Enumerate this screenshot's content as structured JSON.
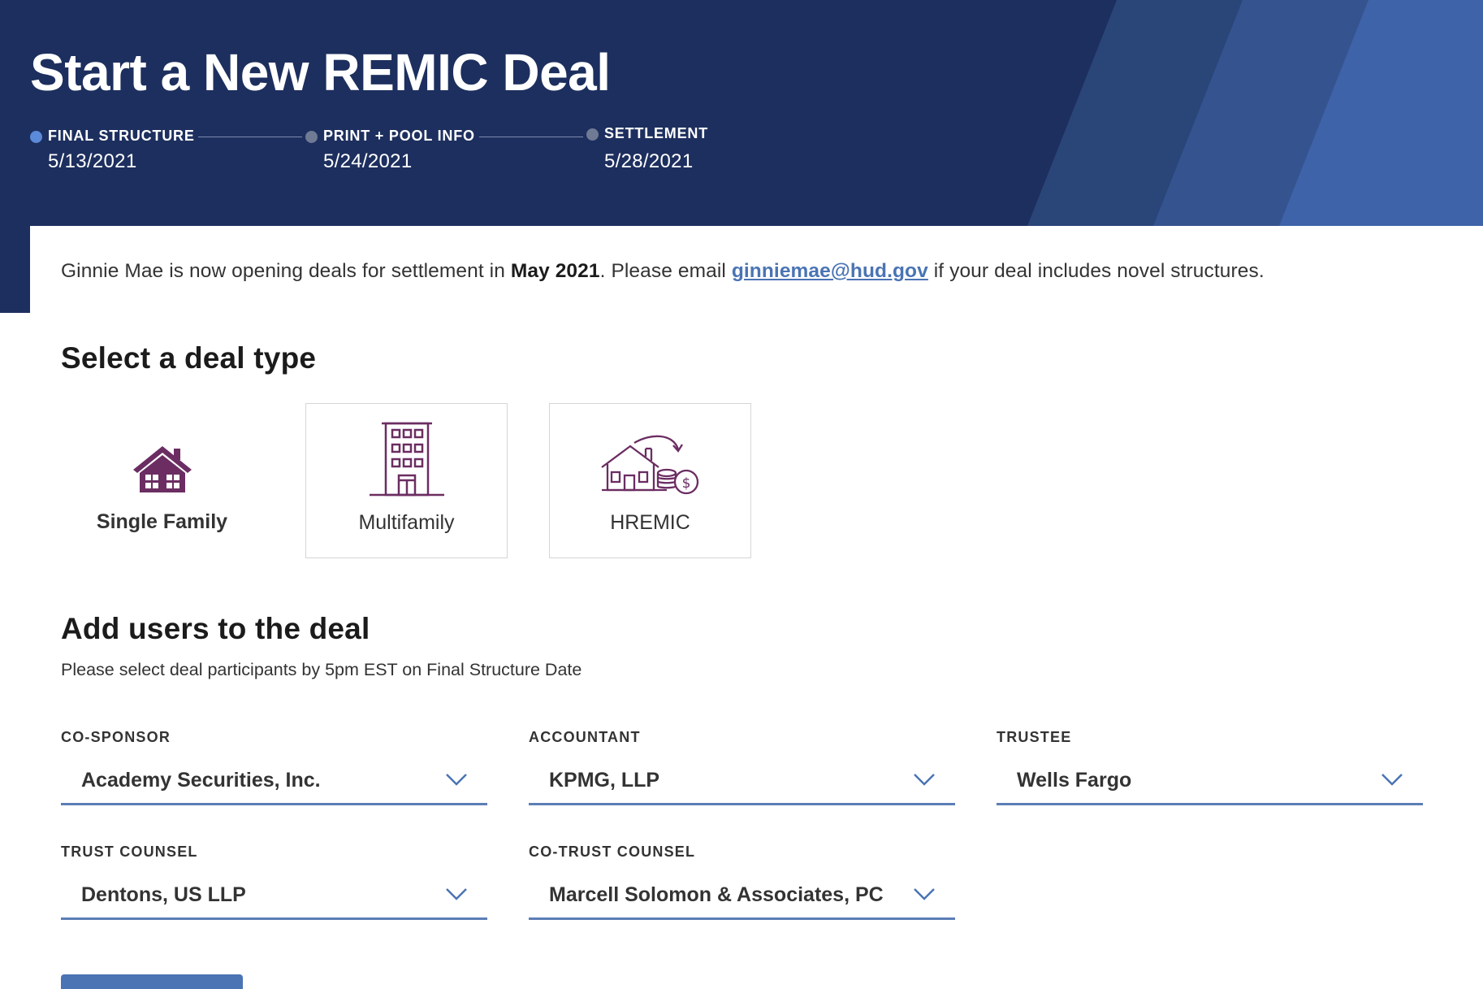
{
  "header": {
    "title": "Start a New REMIC Deal",
    "timeline": [
      {
        "label": "FINAL STRUCTURE",
        "date": "5/13/2021",
        "active": true
      },
      {
        "label": "PRINT + POOL INFO",
        "date": "5/24/2021",
        "active": false
      },
      {
        "label": "SETTLEMENT",
        "date": "5/28/2021",
        "active": false
      }
    ]
  },
  "notice": {
    "before": "Ginnie Mae is now opening deals for settlement in ",
    "bold": "May 2021",
    "middle": ". Please email ",
    "email": "ginniemae@hud.gov",
    "after": " if your deal includes novel structures."
  },
  "deal_type": {
    "title": "Select a deal type",
    "options": [
      {
        "label": "Single Family",
        "icon": "house-icon",
        "selected": true
      },
      {
        "label": "Multifamily",
        "icon": "building-icon",
        "selected": false
      },
      {
        "label": "HREMIC",
        "icon": "house-money-icon",
        "selected": false
      }
    ]
  },
  "users": {
    "title": "Add users to the deal",
    "subtitle": "Please select deal participants by 5pm EST on Final Structure Date",
    "fields": [
      {
        "label": "CO-SPONSOR",
        "value": "Academy Securities, Inc."
      },
      {
        "label": "ACCOUNTANT",
        "value": "KPMG, LLP"
      },
      {
        "label": "TRUSTEE",
        "value": "Wells Fargo"
      },
      {
        "label": "TRUST COUNSEL",
        "value": "Dentons, US LLP"
      },
      {
        "label": "CO-TRUST COUNSEL",
        "value": "Marcell Solomon & Associates, PC"
      }
    ]
  },
  "colors": {
    "header_bg": "#1d2f5e",
    "accent": "#4a74b4",
    "icon_purple": "#6b2d62",
    "active_dot": "#5b8ad8"
  }
}
